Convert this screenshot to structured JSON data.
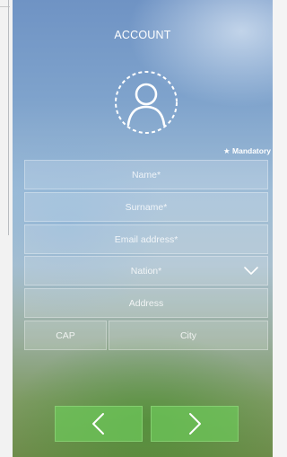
{
  "header": {
    "title": "ACCOUNT"
  },
  "form": {
    "mandatory_note": "Mandatory",
    "name_placeholder": "Name*",
    "surname_placeholder": "Surname*",
    "email_placeholder": "Email address*",
    "nation_placeholder": "Nation*",
    "address_placeholder": "Address",
    "cap_placeholder": "CAP",
    "city_placeholder": "City"
  },
  "icons": {
    "avatar": "user-avatar-icon",
    "mandatory": "star-icon",
    "dropdown": "chevron-down-icon",
    "back": "chevron-left-icon",
    "next": "chevron-right-icon"
  },
  "colors": {
    "button_green": "#6ec85a",
    "text": "#ffffff"
  }
}
